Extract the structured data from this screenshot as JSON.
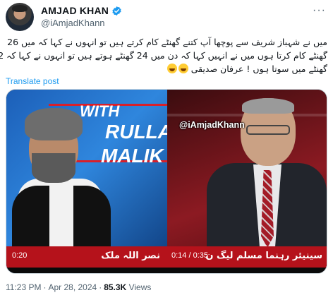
{
  "author": {
    "display_name": "AMJAD KHAN",
    "handle": "@iAmjadKhann",
    "verified": true
  },
  "tweet": {
    "text_lines": [
      "میں نے شہباز شریف سے پوچھا آپ کتنے گھنٹے کام کرتے ہیں تو انہوں نے کہا کہ میں 26",
      "گھنٹے کام کرتا ہوں میں نے انہیں کہا کہ دن میں 24 گھنٹے ہوتے ہیں تو انہوں نے کہا کہ 2",
      "گھنٹے میں سوتا ہوں ! عرفان صدیقی"
    ],
    "emoji": [
      "rolling-on-floor-laughing",
      "rolling-on-floor-laughing"
    ],
    "translate_label": "Translate post"
  },
  "media": {
    "left": {
      "show_title_line1": "WITH",
      "show_title_line2": "RULLAH",
      "show_title_line3": "MALIK",
      "ticker_text": "نصر اللہ ملک",
      "ticker_time": "0:20"
    },
    "right": {
      "ticker_text": "سینیئر رہنما مسلم لیگ ن",
      "ticker_time": "0:14 / 0:35"
    },
    "watermark": "@iAmjadKhann"
  },
  "meta": {
    "time": "11:23 PM",
    "date": "Apr 28, 2024",
    "views_count": "85.3K",
    "views_label": "Views",
    "separator": "·"
  },
  "colors": {
    "link": "#1d9bf0",
    "verified": "#1d9bf0",
    "ticker_red": "#b5121b"
  }
}
